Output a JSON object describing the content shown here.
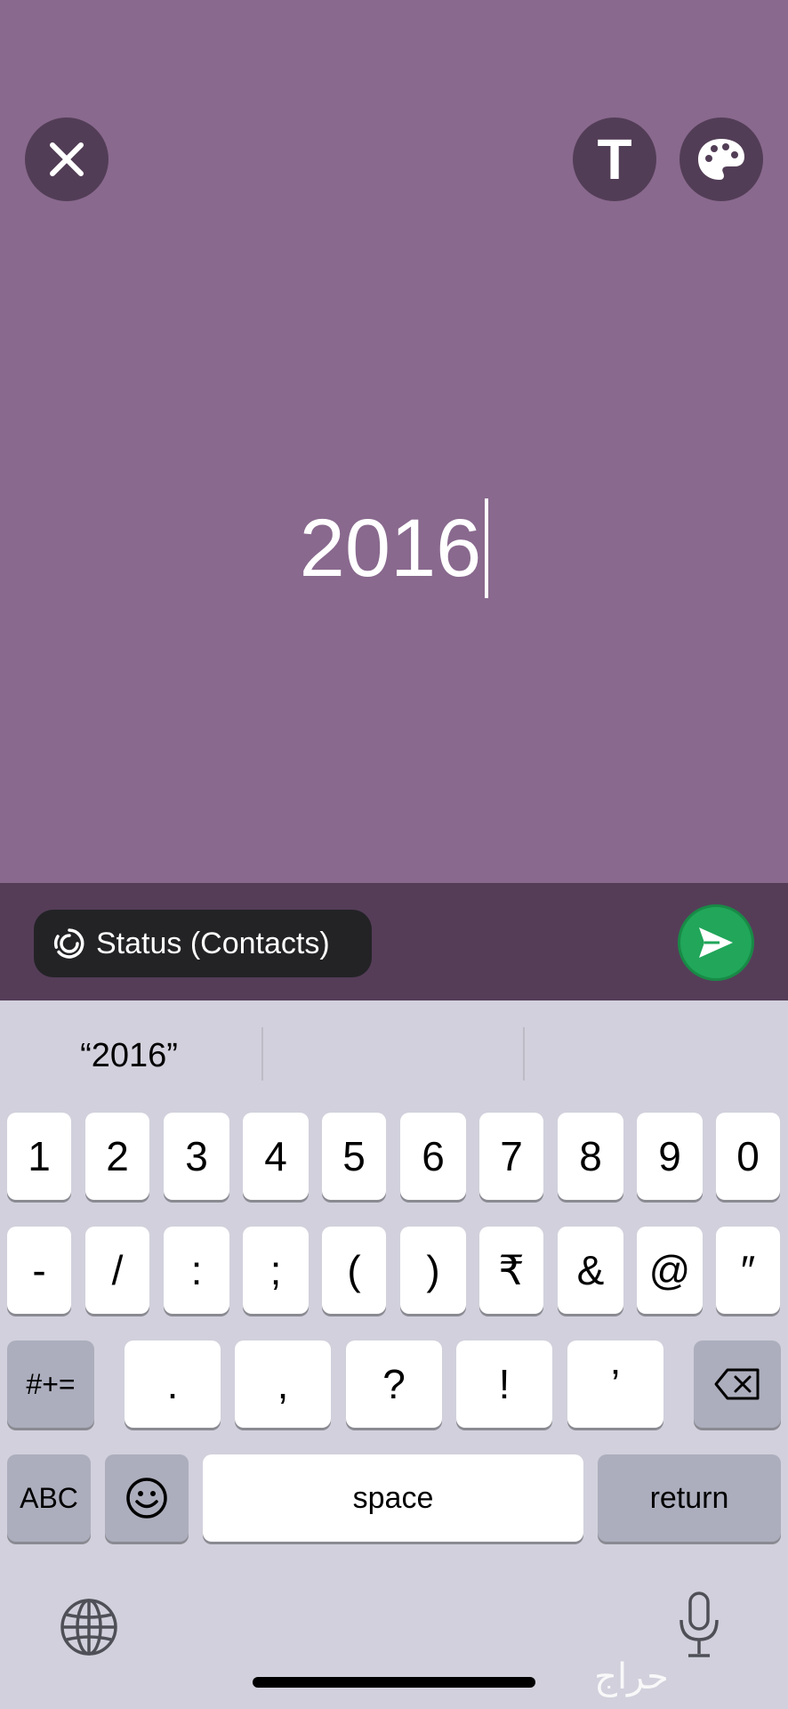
{
  "composer": {
    "status_text": "2016",
    "background_color": "#89698e",
    "buttons": {
      "close_icon": "close-icon",
      "text_style_label": "T",
      "palette_icon": "palette-icon"
    }
  },
  "bottom_bar": {
    "audience_label": "Status (Contacts)",
    "send_color": "#21a65a"
  },
  "keyboard": {
    "suggestions": [
      "“2016”",
      "",
      ""
    ],
    "row1": [
      "1",
      "2",
      "3",
      "4",
      "5",
      "6",
      "7",
      "8",
      "9",
      "0"
    ],
    "row2": [
      "-",
      "/",
      ":",
      ";",
      "(",
      ")",
      "₹",
      "&",
      "@",
      "″"
    ],
    "row3": {
      "shift_label": "#+=",
      "keys": [
        ".",
        ",",
        "?",
        "!",
        "’"
      ]
    },
    "row4": {
      "abc_label": "ABC",
      "space_label": "space",
      "return_label": "return"
    }
  },
  "watermark": "حراج"
}
